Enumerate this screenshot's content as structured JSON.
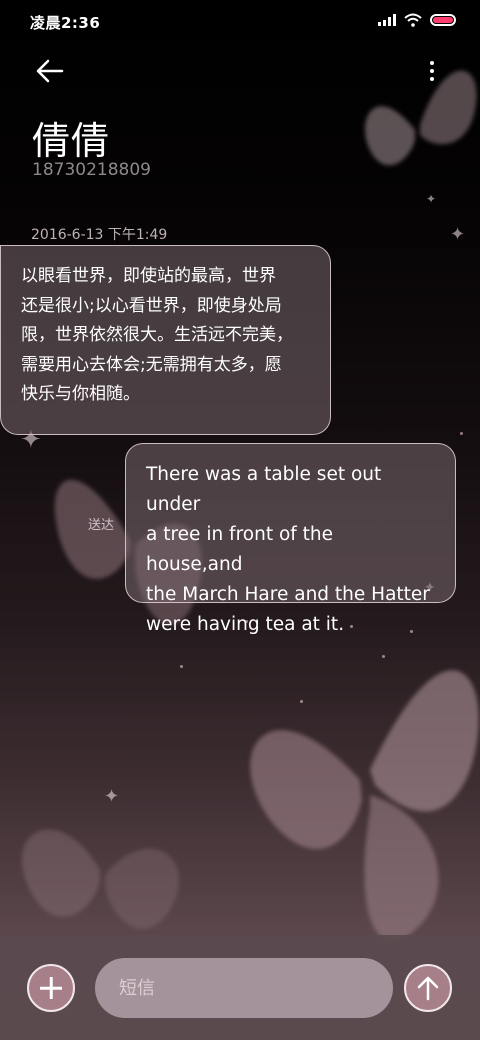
{
  "status_bar": {
    "time": "凌晨2:36",
    "icons": [
      "signal-icon",
      "wifi-icon",
      "battery-icon"
    ]
  },
  "header": {
    "back_icon": "arrow-left-icon",
    "more_icon": "more-vertical-icon",
    "contact_name": "倩倩",
    "contact_number": "18730218809"
  },
  "conversation": {
    "date": "2016-6-13 下午1:49",
    "messages": [
      {
        "direction": "incoming",
        "lines": [
          "以眼看世界，即使站的最高，世界",
          "还是很小;以心看世界，即使身处局",
          "限，世界依然很大。生活远不完美，",
          "需要用心去体会;无需拥有太多，愿",
          "快乐与你相随。"
        ]
      },
      {
        "direction": "outgoing",
        "status": "送达",
        "lines": [
          "There was a table set out under",
          "a tree in front of the house,and",
          "the March Hare and the Hatter",
          "were having tea at it."
        ]
      }
    ]
  },
  "composer": {
    "add_icon": "plus-icon",
    "input_placeholder": "短信",
    "input_value": "",
    "send_icon": "arrow-up-icon"
  },
  "colors": {
    "accent_button": "#a77f88",
    "input_bg": "#a4939a",
    "bubble_border": "#e1d2d6"
  }
}
